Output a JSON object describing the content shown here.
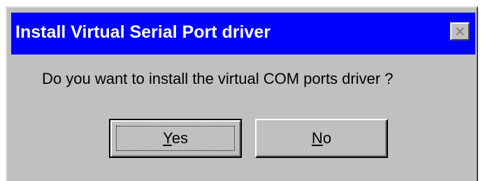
{
  "window": {
    "title": "Install Virtual Serial Port driver",
    "close_icon": "close-icon",
    "colors": {
      "titlebar": "#0000ff",
      "title_text": "#ffffff",
      "face": "#c0c0c0"
    }
  },
  "message": "Do you want to install the virtual COM ports driver ?",
  "buttons": {
    "yes": {
      "mnemonic": "Y",
      "rest": "es",
      "default": true
    },
    "no": {
      "mnemonic": "N",
      "rest": "o",
      "default": false
    }
  }
}
